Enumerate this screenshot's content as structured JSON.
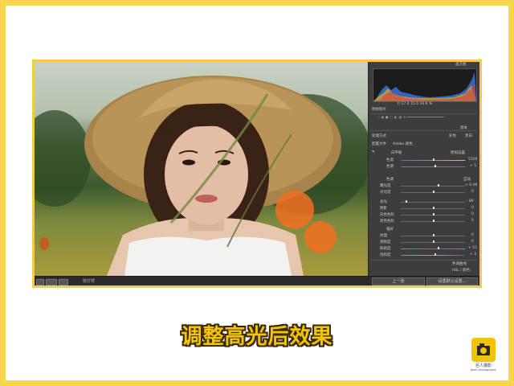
{
  "app": {
    "caption": "调整高光后效果"
  },
  "logo": {
    "name": "巨人摄影",
    "sub": "giant photography"
  },
  "statusbar": {
    "label": "软打样"
  },
  "panel": {
    "top_label": "直方图",
    "hist_readout": [
      "f/",
      "17.4",
      "15.6",
      "16.6",
      "%"
    ],
    "original_photo": "原始照片",
    "basic_header": "基本",
    "treatment_label": "处理方式",
    "treatment_color": "彩色",
    "treatment_bw": "黑白",
    "profile_label": "配置文件",
    "profile_value": "Adobe 颜色",
    "wb_label": "白平衡",
    "wb_value": "原照设置",
    "temp_label": "色温",
    "temp_value": "5100",
    "tint_label": "色调",
    "tint_value": "+ 5",
    "tone_label": "色调",
    "tone_auto": "自动",
    "exposure_label": "曝光度",
    "exposure_value": "+ 0.46",
    "contrast_label": "对比度",
    "contrast_value": "0",
    "highlights_label": "高光",
    "highlights_value": "- 86",
    "shadows_label": "阴影",
    "shadows_value": "0",
    "whites_label": "白色色阶",
    "whites_value": "0",
    "blacks_label": "黑色色阶",
    "blacks_value": "0",
    "presence_label": "偏好",
    "texture_label": "纹理",
    "texture_value": "0",
    "clarity_label": "清晰度",
    "clarity_value": "0",
    "vibrance_label": "鲜艳度",
    "vibrance_value": "+ 15",
    "saturation_label": "饱和度",
    "saturation_value": "+ 3",
    "tone_curve": "色调曲线",
    "hsl": "HSL / 颜色",
    "prev_button": "上一张",
    "reset_button": "设置默认设置..."
  },
  "colors": {
    "frame": "#f7d54a",
    "caption": "#f5c400",
    "panel_bg": "#3d3d3d"
  }
}
